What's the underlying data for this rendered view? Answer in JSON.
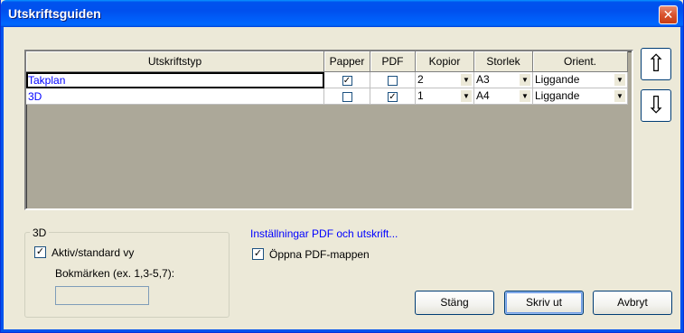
{
  "window": {
    "title": "Utskriftsguiden",
    "close_glyph": "✕"
  },
  "grid": {
    "columns": [
      "Utskriftstyp",
      "Papper",
      "PDF",
      "Kopior",
      "Storlek",
      "Orient."
    ],
    "rows": [
      {
        "name": "Takplan",
        "papper": true,
        "pdf": false,
        "kopior": "2",
        "storlek": "A3",
        "orient": "Liggande"
      },
      {
        "name": "3D",
        "papper": false,
        "pdf": true,
        "kopior": "1",
        "storlek": "A4",
        "orient": "Liggande"
      }
    ],
    "check_glyph": "✓",
    "dropdown_glyph": "▼"
  },
  "move_buttons": {
    "up_glyph": "⇧",
    "down_glyph": "⇩"
  },
  "group_3d": {
    "legend": "3D",
    "aktiv_label": "Aktiv/standard vy",
    "aktiv_checked": true,
    "bookmarks_label": "Bokmärken (ex. 1,3-5,7):",
    "bookmarks_value": ""
  },
  "settings_link": "Inställningar PDF och utskrift...",
  "open_pdf_folder": {
    "label": "Öppna PDF-mappen",
    "checked": true
  },
  "buttons": {
    "close": "Stäng",
    "print": "Skriv ut",
    "cancel": "Avbryt"
  }
}
